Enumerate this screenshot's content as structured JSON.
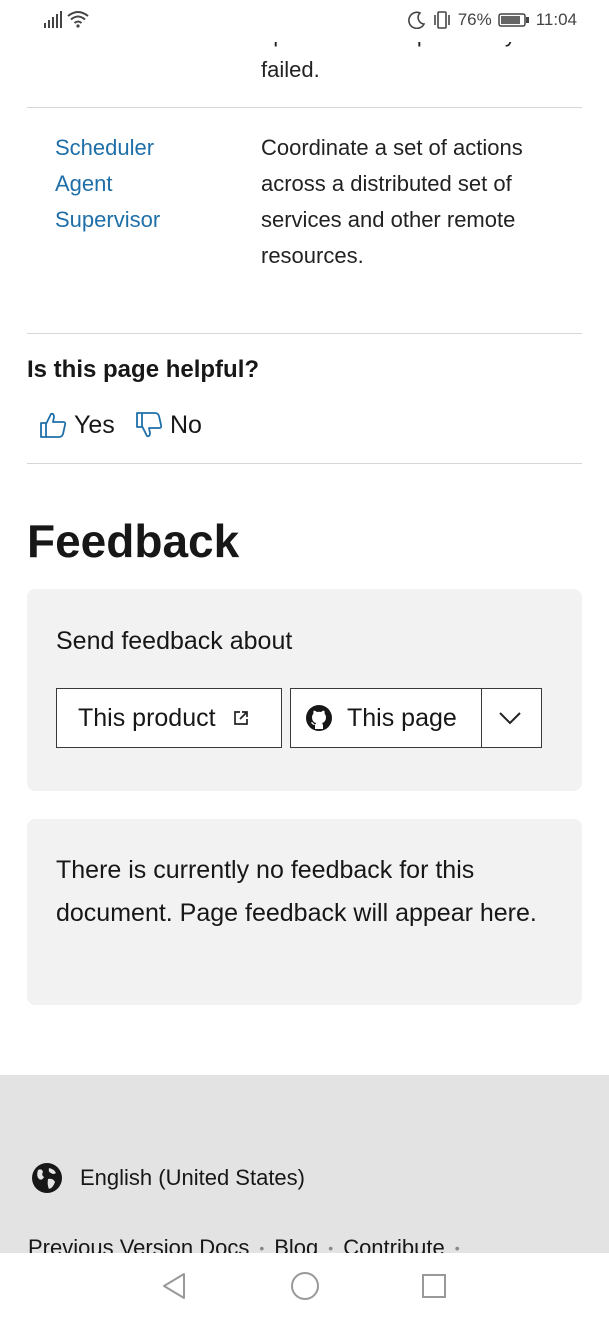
{
  "status_bar": {
    "battery": "76%",
    "time": "11:04",
    "icons": [
      "signal-icon",
      "wifi-icon",
      "moon-icon",
      "vibrate-icon",
      "battery-icon"
    ]
  },
  "table": {
    "prev_row": {
      "clipped_text": "operation that's previously",
      "description_tail": "failed."
    },
    "row": {
      "pattern_lines": [
        "Scheduler",
        "Agent",
        "Supervisor"
      ],
      "description": "Coordinate a set of actions across a distributed set of services and other remote resources."
    }
  },
  "helpful": {
    "question": "Is this page helpful?",
    "yes_label": "Yes",
    "no_label": "No",
    "icons": [
      "thumbs-up-icon",
      "thumbs-down-icon"
    ]
  },
  "feedback": {
    "title": "Feedback",
    "send_label": "Send feedback about",
    "product_button": "This product",
    "page_button": "This page",
    "empty_message": "There is currently no feedback for this document. Page feedback will appear here."
  },
  "footer": {
    "locale": "English (United States)",
    "links": [
      "Previous Version Docs",
      "Blog",
      "Contribute"
    ]
  },
  "colors": {
    "link": "#1f6fa8",
    "panel_background": "#f2f2f2",
    "footer_background": "#e3e3e3",
    "text": "#171717"
  }
}
